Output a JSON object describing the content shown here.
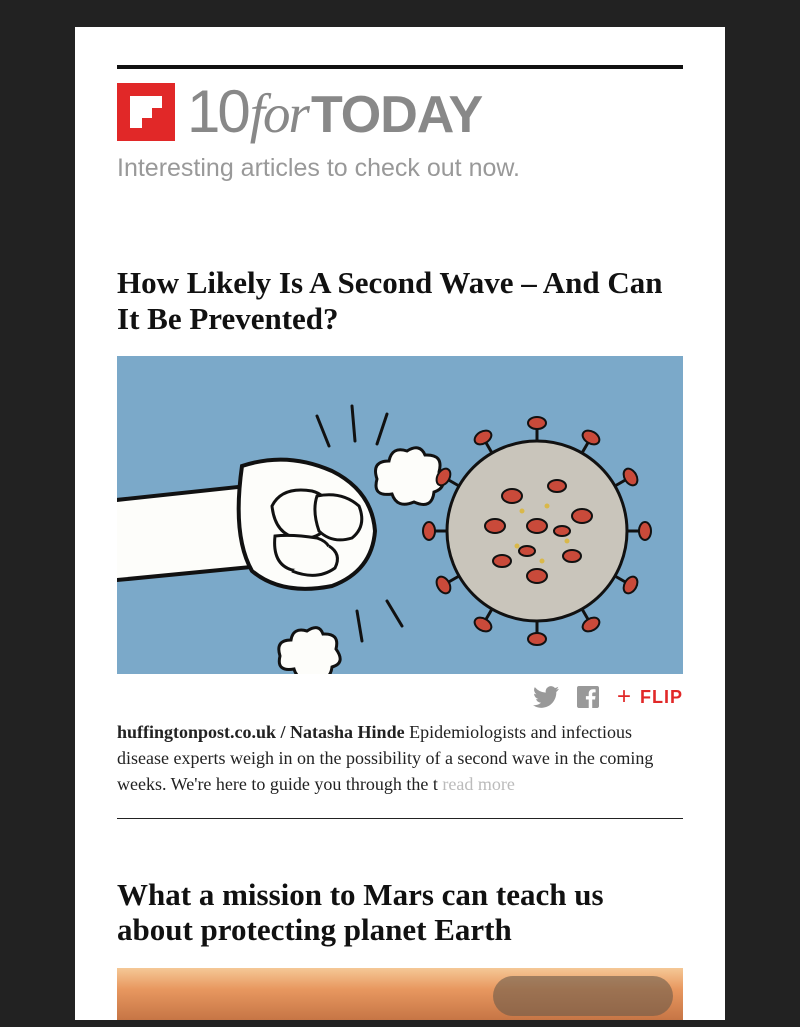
{
  "header": {
    "brand_num": "10",
    "brand_for": "for",
    "brand_today": "TODAY",
    "tagline": "Interesting articles to check out now."
  },
  "actions": {
    "flip_label": "FLIP"
  },
  "articles": [
    {
      "title": "How Likely Is A Second Wave – And Can It Be Prevented?",
      "source": "huffingtonpost.co.uk / Natasha Hinde",
      "excerpt": " Epidemiologists and infectious disease experts weigh in on the possibility of a second wave in the coming weeks. We're here to guide you through the t ",
      "read_more": "read more"
    },
    {
      "title": "What a mission to Mars can teach us about protecting planet Earth"
    }
  ]
}
